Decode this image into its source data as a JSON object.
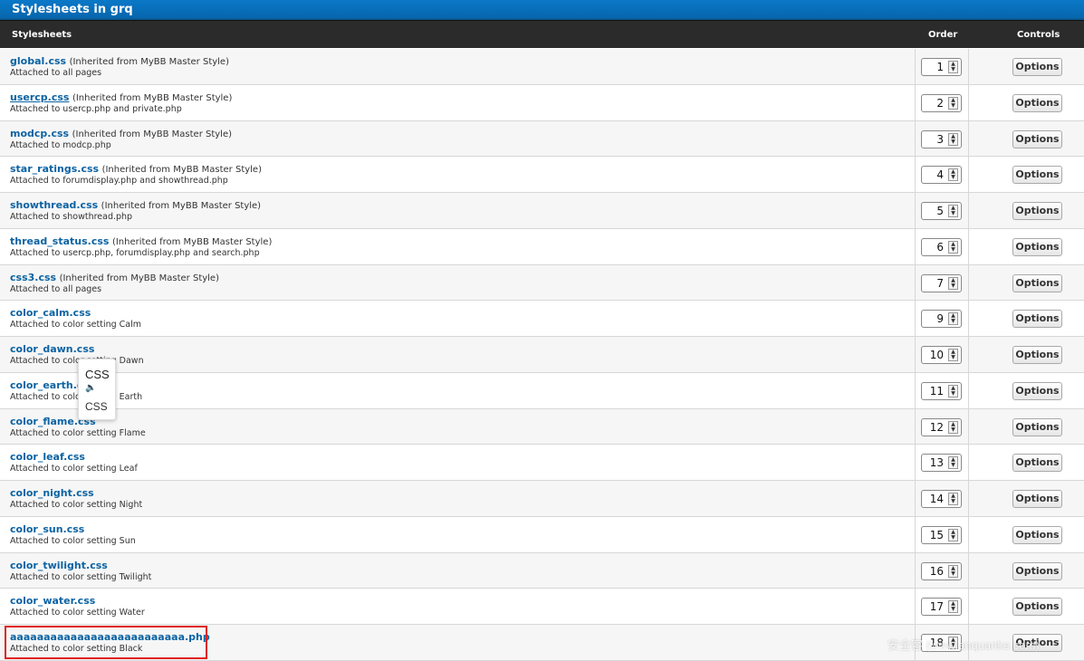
{
  "title": "Stylesheets in grq",
  "columns": {
    "stylesheets": "Stylesheets",
    "order": "Order",
    "controls": "Controls"
  },
  "options_label": "Options",
  "rows": [
    {
      "name": "global.css",
      "inherited": "(Inherited from MyBB Master Style)",
      "attached": "Attached to all pages",
      "order": "1"
    },
    {
      "name": "usercp.css",
      "inherited": "(Inherited from MyBB Master Style)",
      "attached": "Attached to usercp.php and private.php",
      "order": "2"
    },
    {
      "name": "modcp.css",
      "inherited": "(Inherited from MyBB Master Style)",
      "attached": "Attached to modcp.php",
      "order": "3"
    },
    {
      "name": "star_ratings.css",
      "inherited": "(Inherited from MyBB Master Style)",
      "attached": "Attached to forumdisplay.php and showthread.php",
      "order": "4"
    },
    {
      "name": "showthread.css",
      "inherited": "(Inherited from MyBB Master Style)",
      "attached": "Attached to showthread.php",
      "order": "5"
    },
    {
      "name": "thread_status.css",
      "inherited": "(Inherited from MyBB Master Style)",
      "attached": "Attached to usercp.php, forumdisplay.php and search.php",
      "order": "6"
    },
    {
      "name": "css3.css",
      "inherited": "(Inherited from MyBB Master Style)",
      "attached": "Attached to all pages",
      "order": "7"
    },
    {
      "name": "color_calm.css",
      "inherited": "",
      "attached": "Attached to color setting Calm",
      "order": "9"
    },
    {
      "name": "color_dawn.css",
      "inherited": "",
      "attached": "Attached to color setting Dawn",
      "order": "10"
    },
    {
      "name": "color_earth.css",
      "inherited": "",
      "attached": "Attached to color setting Earth",
      "order": "11"
    },
    {
      "name": "color_flame.css",
      "inherited": "",
      "attached": "Attached to color setting Flame",
      "order": "12"
    },
    {
      "name": "color_leaf.css",
      "inherited": "",
      "attached": "Attached to color setting Leaf",
      "order": "13"
    },
    {
      "name": "color_night.css",
      "inherited": "",
      "attached": "Attached to color setting Night",
      "order": "14"
    },
    {
      "name": "color_sun.css",
      "inherited": "",
      "attached": "Attached to color setting Sun",
      "order": "15"
    },
    {
      "name": "color_twilight.css",
      "inherited": "",
      "attached": "Attached to color setting Twilight",
      "order": "16"
    },
    {
      "name": "color_water.css",
      "inherited": "",
      "attached": "Attached to color setting Water",
      "order": "17"
    },
    {
      "name": "aaaaaaaaaaaaaaaaaaaaaaaaaa.php",
      "inherited": "",
      "attached": "Attached to color setting Black",
      "order": "18"
    }
  ],
  "tooltip": {
    "word": "CSS",
    "speaker_icon": "speaker-icon",
    "translation": "CSS"
  },
  "watermark": "安全客 (www.anquanke.com)",
  "colors": {
    "header_blue": "#0766ad",
    "header_dark": "#2b2b2b",
    "link_blue": "#0b63a3",
    "highlight_red": "#e02020"
  }
}
